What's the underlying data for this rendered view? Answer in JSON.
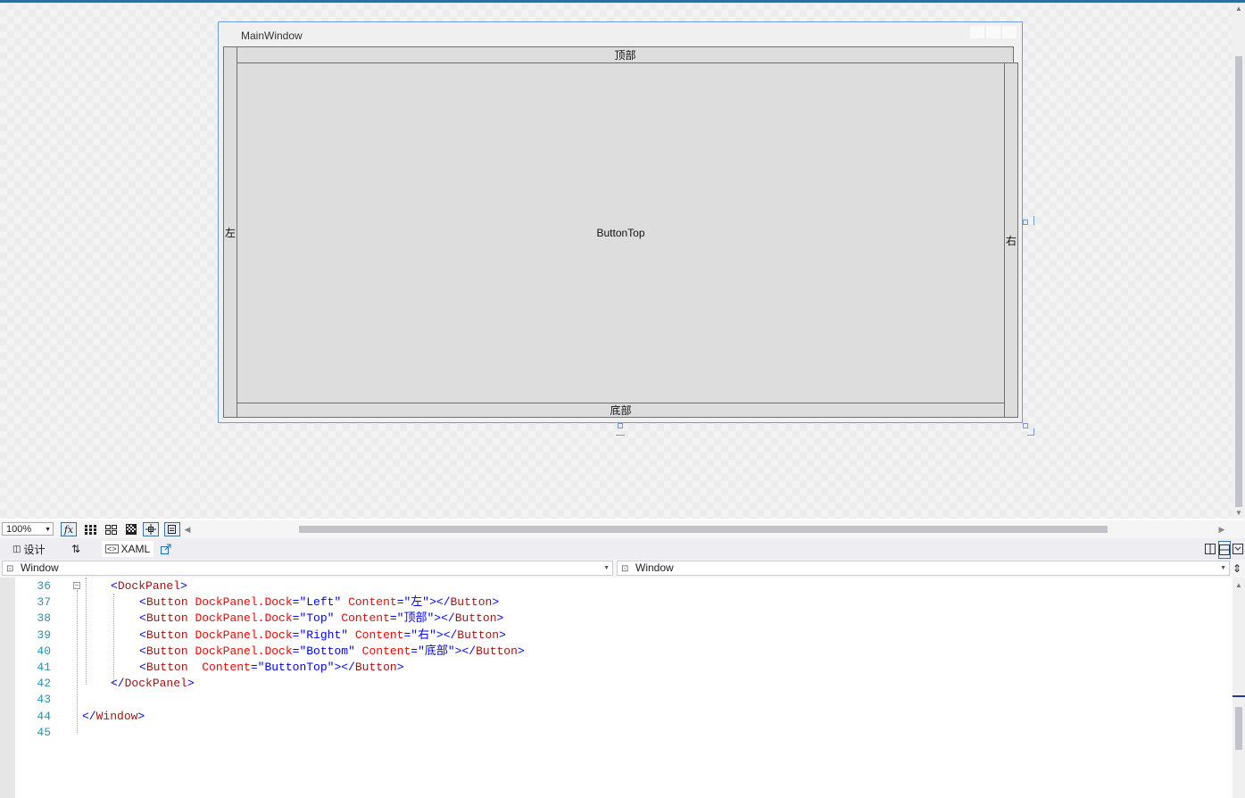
{
  "window": {
    "title": "MainWindow"
  },
  "buttons": {
    "left": "左",
    "top": "顶部",
    "right": "右",
    "bottom": "底部",
    "fill": "ButtonTop"
  },
  "toolbar": {
    "zoom": "100%",
    "fx_label": "fx"
  },
  "tabs": {
    "design": "设计",
    "swap_icon": "⇅",
    "xaml": "XAML"
  },
  "combos": {
    "left_value": "Window",
    "right_value": "Window"
  },
  "code": {
    "lines": [
      {
        "n": "36",
        "parts": [
          [
            "p",
            "<"
          ],
          [
            "t",
            "DockPanel"
          ],
          [
            "p",
            ">"
          ]
        ]
      },
      {
        "n": "37",
        "parts": [
          [
            "p",
            "<"
          ],
          [
            "t",
            "Button"
          ],
          [
            "p",
            " "
          ],
          [
            "a",
            "DockPanel.Dock"
          ],
          [
            "p",
            "=\"Left\" "
          ],
          [
            "a",
            "Content"
          ],
          [
            "p",
            "=\"左\"></"
          ],
          [
            "t",
            "Button"
          ],
          [
            "p",
            ">"
          ]
        ]
      },
      {
        "n": "38",
        "parts": [
          [
            "p",
            "<"
          ],
          [
            "t",
            "Button"
          ],
          [
            "p",
            " "
          ],
          [
            "a",
            "DockPanel.Dock"
          ],
          [
            "p",
            "=\"Top\" "
          ],
          [
            "a",
            "Content"
          ],
          [
            "p",
            "=\"顶部\"></"
          ],
          [
            "t",
            "Button"
          ],
          [
            "p",
            ">"
          ]
        ]
      },
      {
        "n": "39",
        "parts": [
          [
            "p",
            "<"
          ],
          [
            "t",
            "Button"
          ],
          [
            "p",
            " "
          ],
          [
            "a",
            "DockPanel.Dock"
          ],
          [
            "p",
            "=\"Right\" "
          ],
          [
            "a",
            "Content"
          ],
          [
            "p",
            "=\"右\"></"
          ],
          [
            "t",
            "Button"
          ],
          [
            "p",
            ">"
          ]
        ]
      },
      {
        "n": "40",
        "parts": [
          [
            "p",
            "<"
          ],
          [
            "t",
            "Button"
          ],
          [
            "p",
            " "
          ],
          [
            "a",
            "DockPanel.Dock"
          ],
          [
            "p",
            "=\"Bottom\" "
          ],
          [
            "a",
            "Content"
          ],
          [
            "p",
            "=\"底部\"></"
          ],
          [
            "t",
            "Button"
          ],
          [
            "p",
            ">"
          ]
        ]
      },
      {
        "n": "41",
        "parts": [
          [
            "p",
            "<"
          ],
          [
            "t",
            "Button"
          ],
          [
            "p",
            "  "
          ],
          [
            "a",
            "Content"
          ],
          [
            "p",
            "=\"ButtonTop\"></"
          ],
          [
            "t",
            "Button"
          ],
          [
            "p",
            ">"
          ]
        ]
      },
      {
        "n": "42",
        "parts": [
          [
            "p",
            "</"
          ],
          [
            "t",
            "DockPanel"
          ],
          [
            "p",
            ">"
          ]
        ]
      },
      {
        "n": "43",
        "parts": []
      },
      {
        "n": "44",
        "parts": [
          [
            "p",
            "</"
          ],
          [
            "t",
            "Window"
          ],
          [
            "p",
            ">"
          ]
        ]
      },
      {
        "n": "45",
        "parts": []
      }
    ]
  }
}
